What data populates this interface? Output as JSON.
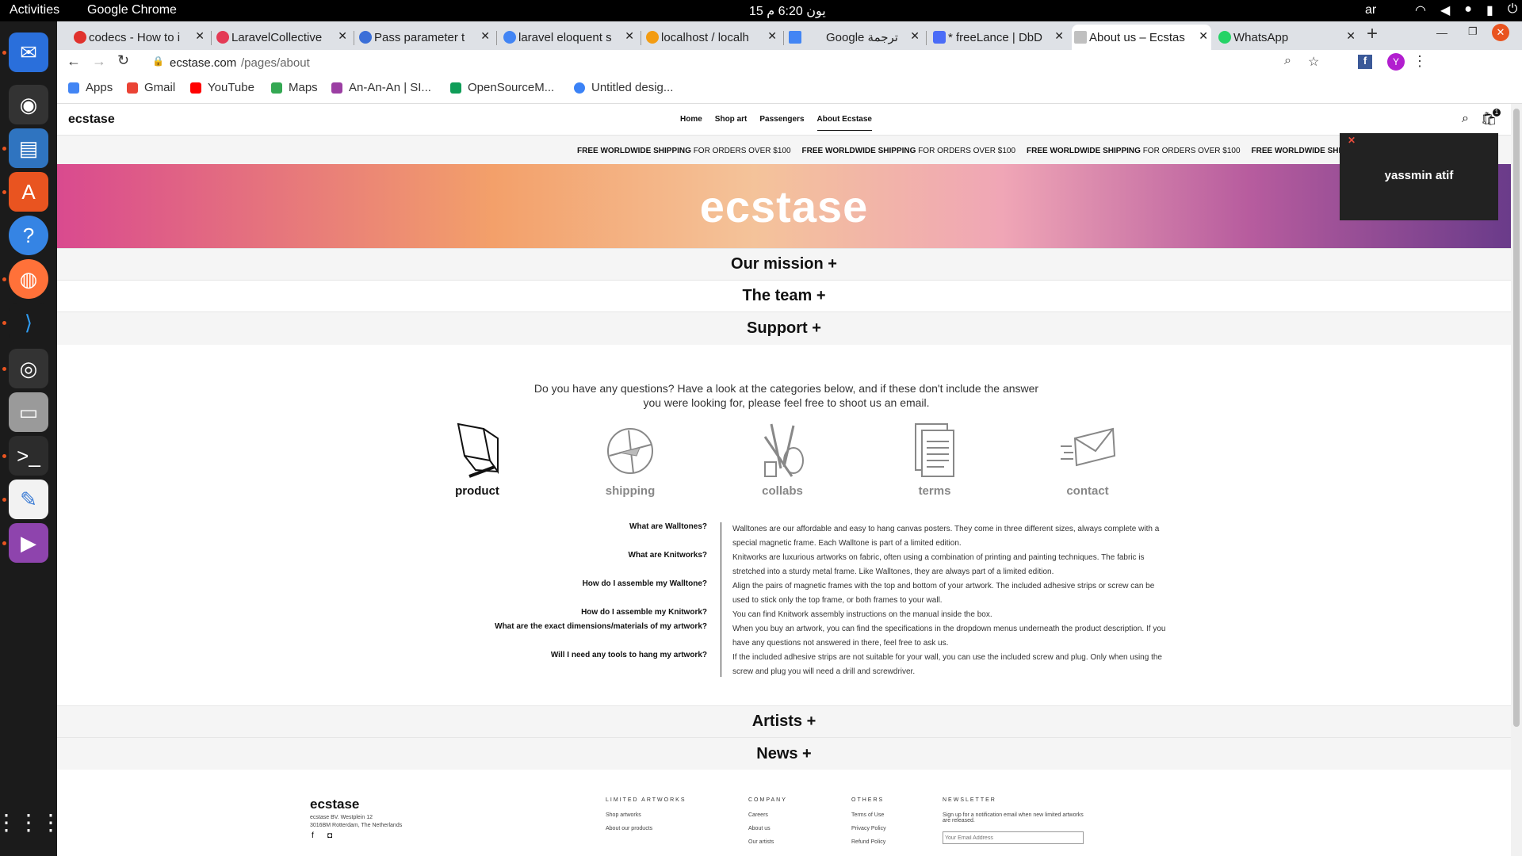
{
  "os": {
    "activities": "Activities",
    "app_name": "Google Chrome",
    "clock": "15 يون  6:20 م",
    "lang": "ar"
  },
  "tabs": [
    {
      "label": "codecs - How to i",
      "color": "#e0322d"
    },
    {
      "label": "LaravelCollective",
      "color": "#e43a55"
    },
    {
      "label": "Pass parameter t",
      "color": "#3b6fd8"
    },
    {
      "label": "laravel eloquent s",
      "color": "#4285f4"
    },
    {
      "label": "localhost / localh",
      "color": "#f39c12"
    },
    {
      "label": "Google ترجمة",
      "color": "#4285f4"
    },
    {
      "label": "* freeLance | DbD",
      "color": "#4a6cf7"
    },
    {
      "label": "About us – Ecstas",
      "color": "#c0c0c0"
    },
    {
      "label": "WhatsApp",
      "color": "#25d366"
    }
  ],
  "address": {
    "host": "ecstase.com",
    "path": "/pages/about"
  },
  "bookmarks": [
    {
      "label": "Apps",
      "color": "#4285f4"
    },
    {
      "label": "Gmail",
      "color": "#ea4335"
    },
    {
      "label": "YouTube",
      "color": "#ff0000"
    },
    {
      "label": "Maps",
      "color": "#34a853"
    },
    {
      "label": "An-An-An | SI...",
      "color": "#9b3ea3"
    },
    {
      "label": "OpenSourceM...",
      "color": "#0f9d58"
    },
    {
      "label": "Untitled desig...",
      "color": "#3b82f6"
    }
  ],
  "site": {
    "logo": "ecstase",
    "nav": [
      "Home",
      "Shop art",
      "Passengers",
      "About Ecstase"
    ],
    "shipping": {
      "bold": "FREE WORLDWIDE SHIPPING",
      "rest": "FOR ORDERS OVER $100"
    },
    "hero_title": "ecstase",
    "accordions": [
      "Our mission +",
      "The team +",
      "Support +",
      "Artists +",
      "News +"
    ],
    "intro": "Do you have any questions? Have a look at the categories below, and if these don't include the answer you were looking for, please feel free to shoot us an email.",
    "categories": [
      "product",
      "shipping",
      "collabs",
      "terms",
      "contact"
    ],
    "faq": [
      {
        "q": "What are Walltones?",
        "a": "Walltones are our affordable and easy to hang canvas posters. They come in three different sizes, always complete with a special magnetic frame. Each Walltone is part of a limited edition."
      },
      {
        "q": "What are Knitworks?",
        "a": "Knitworks are luxurious artworks on fabric, often using a combination of printing and painting techniques. The fabric is stretched into a sturdy metal frame. Like Walltones, they are always part of a limited edition."
      },
      {
        "q": "How do I assemble my Walltone?",
        "a": "Align the pairs of magnetic frames with the top and bottom of your artwork. The included adhesive strips or screw can be used to stick only the top frame, or both frames to your wall."
      },
      {
        "q": "How do I assemble my Knitwork?",
        "a": "You can find Knitwork assembly instructions on the manual inside the box."
      },
      {
        "q": "What are the exact dimensions/materials of my artwork?",
        "a": "When you buy an artwork, you can find the specifications in the dropdown menus underneath the product description. If you have any questions not answered in there, feel free to ask us."
      },
      {
        "q": "Will I need any tools to hang my artwork?",
        "a": "If the included adhesive strips are not suitable for your wall, you can use the included screw and plug. Only when using the screw and plug you will need a drill and screwdriver."
      }
    ],
    "footer": {
      "logo": "ecstase",
      "address1": "ecstase BV. Westplein 12",
      "address2": "3016BM Rotterdam, The Netherlands",
      "cols": [
        {
          "title": "LIMITED ARTWORKS",
          "items": [
            "Shop artworks",
            "About our products"
          ]
        },
        {
          "title": "COMPANY",
          "items": [
            "Careers",
            "About us",
            "Our artists"
          ]
        },
        {
          "title": "OTHERS",
          "items": [
            "Terms of Use",
            "Privacy Policy",
            "Refund Policy"
          ]
        },
        {
          "title": "NEWSLETTER",
          "items": [
            "Sign up for a notification email when new limited artworks are released."
          ]
        }
      ],
      "email_placeholder": "Your Email Address"
    },
    "cart_count": "1"
  },
  "popup": {
    "name": "yassmin atif"
  }
}
